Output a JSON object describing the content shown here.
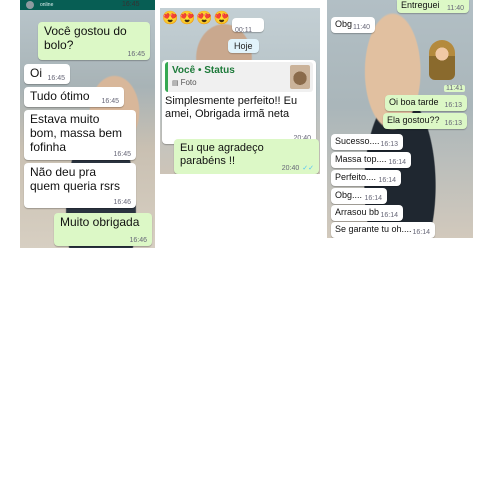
{
  "panel1": {
    "header_status": "online",
    "header_time": "16:45",
    "messages": [
      {
        "text": "Você gostou do\nbolo?",
        "time": "16:45",
        "dir": "out"
      },
      {
        "text": "Oi",
        "time": "16:45",
        "dir": "in"
      },
      {
        "text": "Tudo ótimo",
        "time": "16:45",
        "dir": "in"
      },
      {
        "text": "Estava muito\nbom, massa bem\nfofinha",
        "time": "16:45",
        "dir": "in"
      },
      {
        "text": "Não deu pra\nquem queria rsrs",
        "time": "16:46",
        "dir": "in"
      },
      {
        "text": "Muito obrigada",
        "time": "16:46",
        "dir": "out"
      }
    ]
  },
  "panel2": {
    "emojis": "😍😍😍😍",
    "emoji_time": "00:11",
    "date_label": "Hoje",
    "status_reply": {
      "title": "Você • Status",
      "subtitle": "Foto",
      "text": "Simplesmente  perfeito!! Eu\namei, Obrigada irmã neta",
      "time": "20:40"
    },
    "reply": {
      "text": "Eu que agradeço\nparabéns !!",
      "time": "20:40"
    }
  },
  "panel3": {
    "messages": [
      {
        "text": "Entreguei",
        "time": "11:40",
        "dir": "out"
      },
      {
        "text": "Obg",
        "time": "11:40",
        "dir": "in"
      },
      {
        "text": "",
        "time": "11:41",
        "dir": "out"
      },
      {
        "text": "Oi boa tarde",
        "time": "16:13",
        "dir": "out"
      },
      {
        "text": "Ela gostou??",
        "time": "16:13",
        "dir": "out"
      },
      {
        "text": "Sucesso....",
        "time": "16:13",
        "dir": "in"
      },
      {
        "text": "Massa top....",
        "time": "16:14",
        "dir": "in"
      },
      {
        "text": "Perfeito....",
        "time": "16:14",
        "dir": "in"
      },
      {
        "text": "Obg....",
        "time": "16:14",
        "dir": "in"
      },
      {
        "text": "Arrasou bb",
        "time": "16:14",
        "dir": "in"
      },
      {
        "text": "Se garante tu oh....",
        "time": "16:14",
        "dir": "in"
      }
    ]
  },
  "colors": {
    "outgoing": "#dcf8c6",
    "incoming": "#ffffff",
    "header": "#075e54",
    "read_ticks": "#4fc3f7"
  }
}
